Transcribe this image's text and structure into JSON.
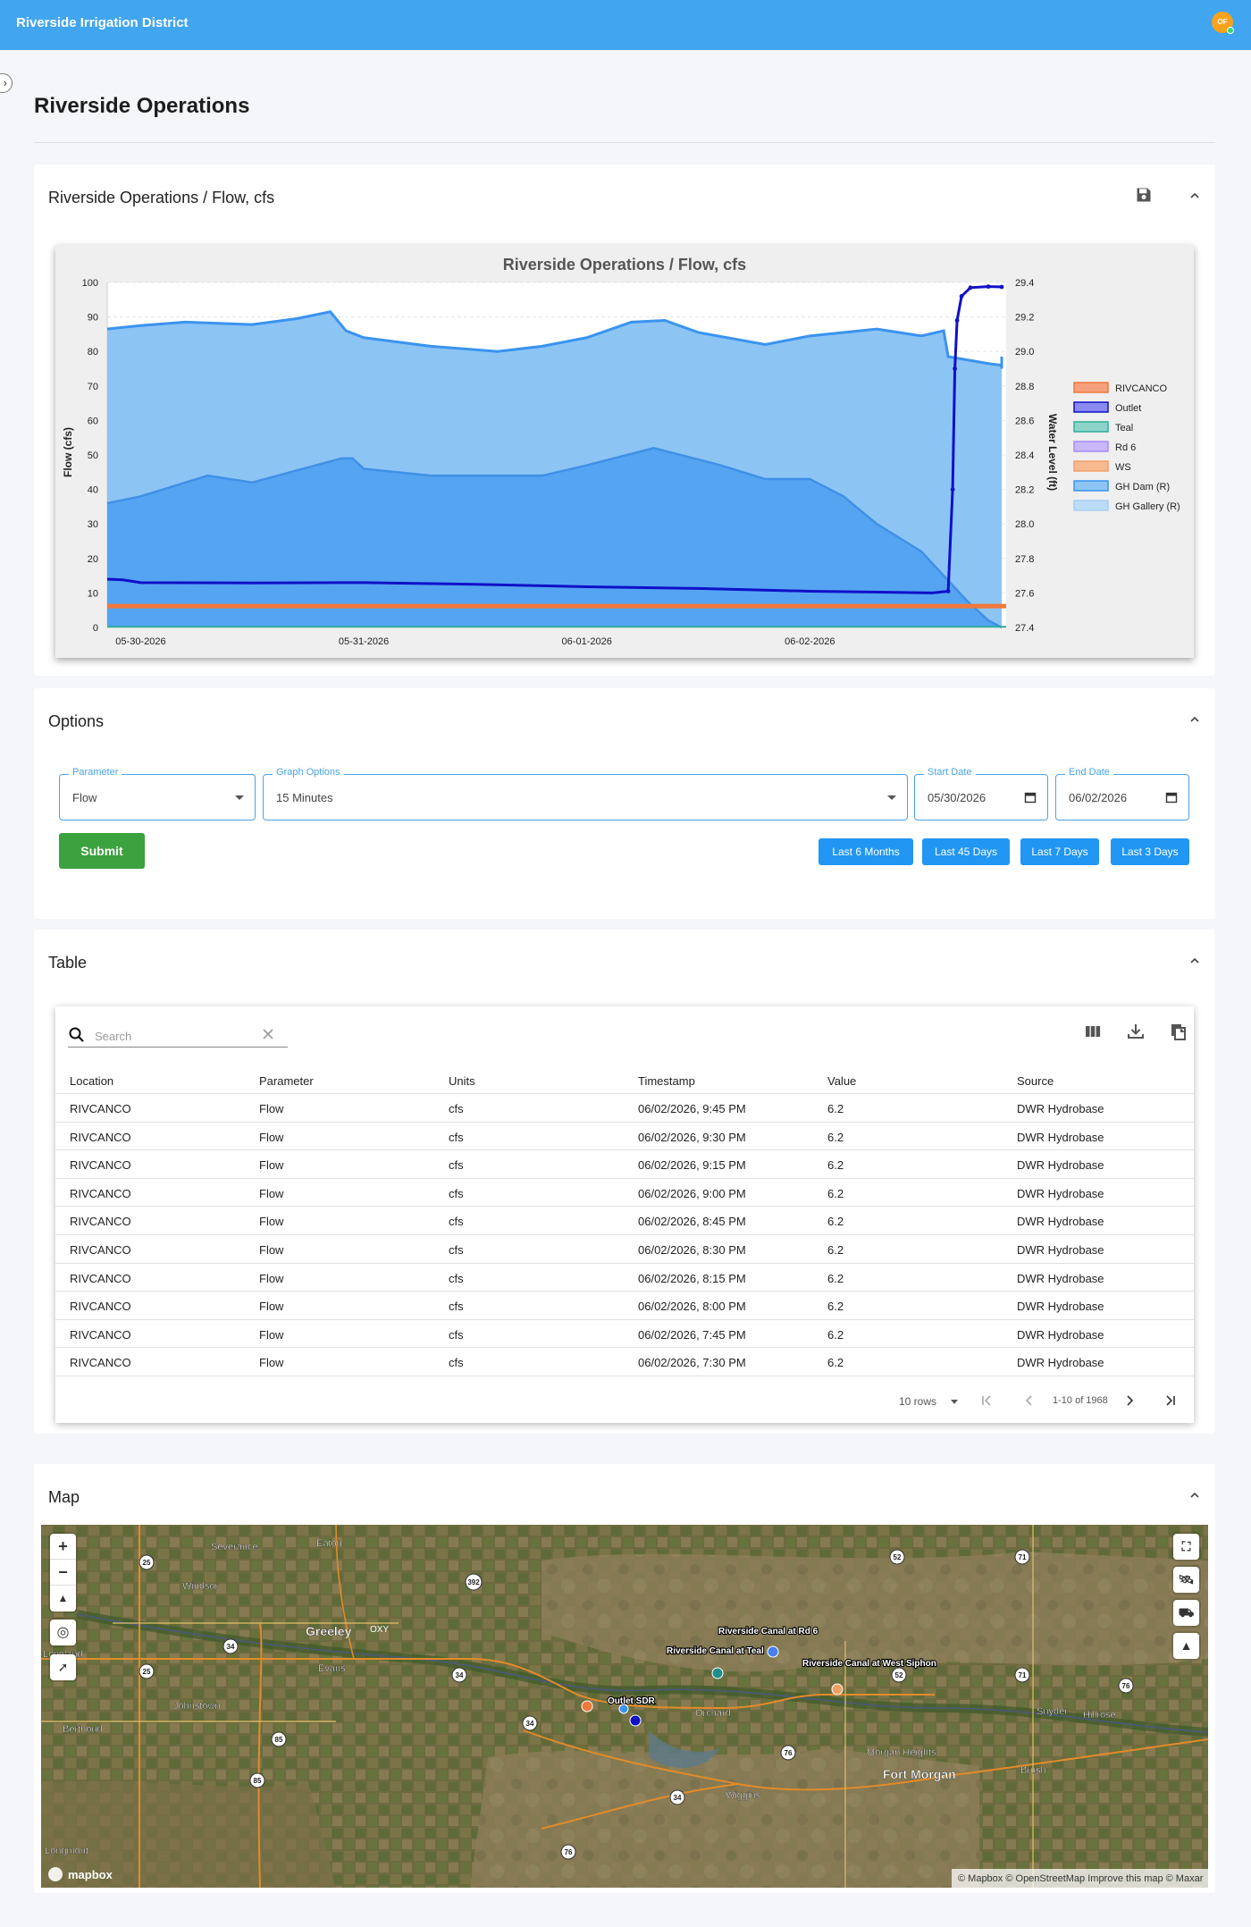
{
  "topbar": {
    "brand": "Riverside Irrigation District",
    "avatar_initials": "OF"
  },
  "page": {
    "title": "Riverside Operations"
  },
  "chart_card": {
    "title": "Riverside Operations / Flow, cfs",
    "icons": {
      "save": "save-icon",
      "collapse": "chevron-up-icon"
    }
  },
  "chart_data": {
    "type": "area",
    "title": "Riverside Operations / Flow, cfs",
    "ylabel": "Flow (cfs)",
    "y2label": "Water Level (ft)",
    "ylim": [
      0,
      100
    ],
    "y2lim": [
      27.4,
      29.4
    ],
    "yticks": [
      "0",
      "10",
      "20",
      "30",
      "40",
      "50",
      "60",
      "70",
      "80",
      "90",
      "100"
    ],
    "y2ticks": [
      "27.4",
      "27.6",
      "27.8",
      "28.0",
      "28.2",
      "28.4",
      "28.6",
      "28.8",
      "29.0",
      "29.2",
      "29.4"
    ],
    "xticks": [
      "05-30-2026",
      "05-31-2026",
      "06-01-2026",
      "06-02-2026"
    ],
    "xlim_days": [
      -0.15,
      3.88
    ],
    "legend_position": "right",
    "series": [
      {
        "name": "RIVCANCO",
        "axis": "left",
        "color": "#f0783c",
        "points": [
          [
            -0.15,
            6.2
          ],
          [
            3.88,
            6.2
          ]
        ]
      },
      {
        "name": "Outlet",
        "axis": "left",
        "color": "#1010c8",
        "points": [
          [
            -0.15,
            14.0
          ],
          [
            -0.08,
            13.8
          ],
          [
            0.0,
            13.0
          ],
          [
            0.5,
            12.9
          ],
          [
            1.0,
            13.0
          ],
          [
            1.5,
            12.5
          ],
          [
            2.0,
            11.8
          ],
          [
            2.5,
            11.3
          ],
          [
            3.0,
            10.5
          ],
          [
            3.35,
            10.2
          ],
          [
            3.55,
            10.0
          ],
          [
            3.62,
            10.5
          ],
          [
            3.64,
            40
          ],
          [
            3.65,
            75
          ],
          [
            3.66,
            89
          ],
          [
            3.68,
            96
          ],
          [
            3.72,
            98.5
          ],
          [
            3.8,
            98.8
          ],
          [
            3.86,
            98.7
          ]
        ]
      },
      {
        "name": "Teal",
        "axis": "left",
        "color": "#2eae9c",
        "points": [
          [
            -0.15,
            0.2
          ],
          [
            3.88,
            0.2
          ]
        ]
      },
      {
        "name": "Rd 6",
        "axis": "left",
        "color": "#a78bfa",
        "points": []
      },
      {
        "name": "WS",
        "axis": "left",
        "color": "#f2a06a",
        "points": []
      },
      {
        "name": "GH Dam (R)",
        "axis": "right",
        "color": "#3a93f0",
        "points": [
          [
            -0.15,
            28.12
          ],
          [
            0.0,
            28.16
          ],
          [
            0.3,
            28.28
          ],
          [
            0.5,
            28.24
          ],
          [
            0.9,
            28.38
          ],
          [
            0.95,
            28.38
          ],
          [
            1.0,
            28.32
          ],
          [
            1.3,
            28.28
          ],
          [
            1.8,
            28.28
          ],
          [
            2.0,
            28.34
          ],
          [
            2.3,
            28.44
          ],
          [
            2.6,
            28.34
          ],
          [
            2.8,
            28.26
          ],
          [
            3.0,
            28.26
          ],
          [
            3.15,
            28.16
          ],
          [
            3.3,
            28.0
          ],
          [
            3.5,
            27.84
          ],
          [
            3.7,
            27.56
          ],
          [
            3.8,
            27.44
          ],
          [
            3.86,
            27.4
          ]
        ]
      },
      {
        "name": "GH Gallery (R)",
        "axis": "right",
        "color": "#a9cff7",
        "points": []
      }
    ],
    "upper_band": [
      [
        -0.15,
        86.5
      ],
      [
        0.0,
        87.5
      ],
      [
        0.2,
        88.5
      ],
      [
        0.5,
        87.8
      ],
      [
        0.7,
        89.5
      ],
      [
        0.85,
        91.5
      ],
      [
        0.92,
        86
      ],
      [
        1.0,
        84
      ],
      [
        1.3,
        81.5
      ],
      [
        1.6,
        80.0
      ],
      [
        1.8,
        81.5
      ],
      [
        2.0,
        84
      ],
      [
        2.2,
        88.5
      ],
      [
        2.35,
        89.0
      ],
      [
        2.5,
        85.5
      ],
      [
        2.8,
        82
      ],
      [
        3.0,
        84.5
      ],
      [
        3.3,
        86.5
      ],
      [
        3.5,
        84.5
      ],
      [
        3.6,
        86.0
      ],
      [
        3.62,
        78.5
      ],
      [
        3.8,
        76.5
      ],
      [
        3.86,
        76.0
      ],
      [
        4.0,
        75.0
      ],
      [
        4.4,
        75.5
      ],
      [
        4.6,
        77.0
      ],
      [
        4.7,
        78.5
      ],
      [
        4.82,
        78.5
      ]
    ]
  },
  "options_card": {
    "title": "Options",
    "parameter": {
      "label": "Parameter",
      "value": "Flow"
    },
    "graph_options": {
      "label": "Graph Options",
      "value": "15 Minutes"
    },
    "start_date": {
      "label": "Start Date",
      "value": "05/30/2026"
    },
    "end_date": {
      "label": "End Date",
      "value": "06/02/2026"
    },
    "submit": "Submit",
    "ranges": [
      "Last 6 Months",
      "Last 45 Days",
      "Last 7 Days",
      "Last 3 Days"
    ]
  },
  "table_card": {
    "title": "Table",
    "search_placeholder": "Search",
    "columns": [
      "Location",
      "Parameter",
      "Units",
      "Timestamp",
      "Value",
      "Source"
    ],
    "rows": [
      [
        "RIVCANCO",
        "Flow",
        "cfs",
        "06/02/2026, 9:45 PM",
        "6.2",
        "DWR Hydrobase"
      ],
      [
        "RIVCANCO",
        "Flow",
        "cfs",
        "06/02/2026, 9:30 PM",
        "6.2",
        "DWR Hydrobase"
      ],
      [
        "RIVCANCO",
        "Flow",
        "cfs",
        "06/02/2026, 9:15 PM",
        "6.2",
        "DWR Hydrobase"
      ],
      [
        "RIVCANCO",
        "Flow",
        "cfs",
        "06/02/2026, 9:00 PM",
        "6.2",
        "DWR Hydrobase"
      ],
      [
        "RIVCANCO",
        "Flow",
        "cfs",
        "06/02/2026, 8:45 PM",
        "6.2",
        "DWR Hydrobase"
      ],
      [
        "RIVCANCO",
        "Flow",
        "cfs",
        "06/02/2026, 8:30 PM",
        "6.2",
        "DWR Hydrobase"
      ],
      [
        "RIVCANCO",
        "Flow",
        "cfs",
        "06/02/2026, 8:15 PM",
        "6.2",
        "DWR Hydrobase"
      ],
      [
        "RIVCANCO",
        "Flow",
        "cfs",
        "06/02/2026, 8:00 PM",
        "6.2",
        "DWR Hydrobase"
      ],
      [
        "RIVCANCO",
        "Flow",
        "cfs",
        "06/02/2026, 7:45 PM",
        "6.2",
        "DWR Hydrobase"
      ],
      [
        "RIVCANCO",
        "Flow",
        "cfs",
        "06/02/2026, 7:30 PM",
        "6.2",
        "DWR Hydrobase"
      ]
    ],
    "rows_per_page": "10 rows",
    "page_info": "1-10 of 1968"
  },
  "map_card": {
    "title": "Map",
    "places": [
      "Severance",
      "Eaton",
      "Windsor",
      "Greeley",
      "Evans",
      "Loveland",
      "Johnstown",
      "Berthoud",
      "Longmont",
      "Orchard",
      "Morgan Heights",
      "Fort Morgan",
      "Brush",
      "Snyder",
      "Hillrose",
      "Wiggins"
    ],
    "shields": [
      "25",
      "392",
      "34",
      "34",
      "85",
      "85",
      "25",
      "52",
      "71",
      "52",
      "71",
      "76",
      "76",
      "76",
      "34",
      "34"
    ],
    "markers": [
      "Riverside Canal at Rd 6",
      "Riverside Canal at Teal",
      "Riverside Canal at West Siphon",
      "Outlet SDR"
    ],
    "marker_colors": [
      "#4a7df0",
      "#1f8f8c",
      "#f2a06a",
      "#f0783c",
      "#1010c8"
    ],
    "oxy_label": "OXY",
    "attribution": "© Mapbox © OpenStreetMap Improve this map © Maxar",
    "logo": "mapbox"
  }
}
